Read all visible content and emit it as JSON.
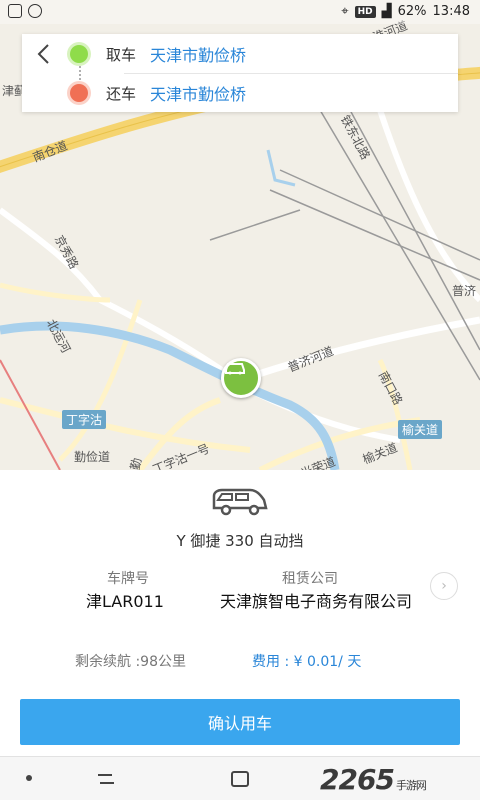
{
  "status_bar": {
    "battery": "62%",
    "time": "13:48",
    "badge": "HD"
  },
  "route": {
    "pickup_label": "取车",
    "pickup_value": "天津市勤俭桥",
    "return_label": "还车",
    "return_value": "天津市勤俭桥"
  },
  "map": {
    "roads": [
      "南仓道",
      "铁东北路",
      "京秀路",
      "北运河",
      "普济河道",
      "南口路",
      "光荣道",
      "榆关道",
      "丁字沽一号",
      "勤俭道",
      "勤"
    ],
    "pois": [
      "丁字沽",
      "榆关道"
    ],
    "station": "勤俭道",
    "edge_labels": [
      "津蓟",
      "淮河道",
      "普济"
    ]
  },
  "car": {
    "name": "Y 御捷 330 自动挡",
    "plate_label": "车牌号",
    "plate_value": "津LAR011",
    "company_label": "租赁公司",
    "company_value": "天津旗智电子商务有限公司",
    "range_text": "剩余续航 :98公里",
    "fee_text": "费用 : ¥ 0.01/ 天",
    "confirm_button": "确认用车"
  },
  "watermark": {
    "brand": "2265",
    "suffix": "手游网"
  },
  "colors": {
    "accent": "#3aa6ee",
    "link": "#2a86d8",
    "pickup_dot": "#8fdc4a",
    "return_dot": "#f07055",
    "car_pin": "#7cc040"
  }
}
